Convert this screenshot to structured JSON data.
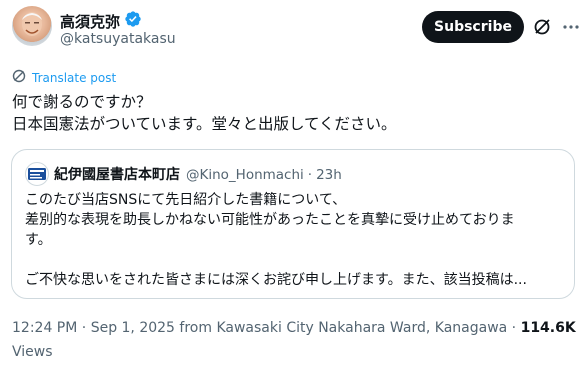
{
  "author": {
    "display_name": "高須克弥",
    "handle": "@katsuyatakasu",
    "verified_icon": "verified-badge-icon",
    "avatar_icon": "avatar"
  },
  "header": {
    "subscribe_label": "Subscribe",
    "grok_icon": "grok-icon",
    "more_icon": "more-options-icon"
  },
  "translate": {
    "label": "Translate post",
    "icon": "globe-icon"
  },
  "post": {
    "lines": [
      "何で謝るのですか？",
      "日本国憲法がついています。堂々と出版してください。"
    ]
  },
  "quote": {
    "name": "紀伊國屋書店本町店",
    "handle": "@Kino_Honmachi",
    "separator": "·",
    "time": "23h",
    "lines": [
      "このたび当店SNSにて先日紹介した書籍について、",
      "差別的な表現を助長しかねない可能性があったことを真摯に受け止めておりま",
      "す。",
      "",
      "ご不快な思いをされた皆さまには深くお詫び申し上げます。また、該当投稿は..."
    ]
  },
  "meta": {
    "time": "12:24 PM",
    "sep": "·",
    "date": "Sep 1, 2025",
    "location": "from Kawasaki City Nakahara Ward, Kanagawa",
    "views_count": "114.6K",
    "views_label": "Views"
  },
  "colors": {
    "accent": "#1d9bf0",
    "text": "#0f1419",
    "muted": "#536471",
    "border": "#cfd9de"
  }
}
